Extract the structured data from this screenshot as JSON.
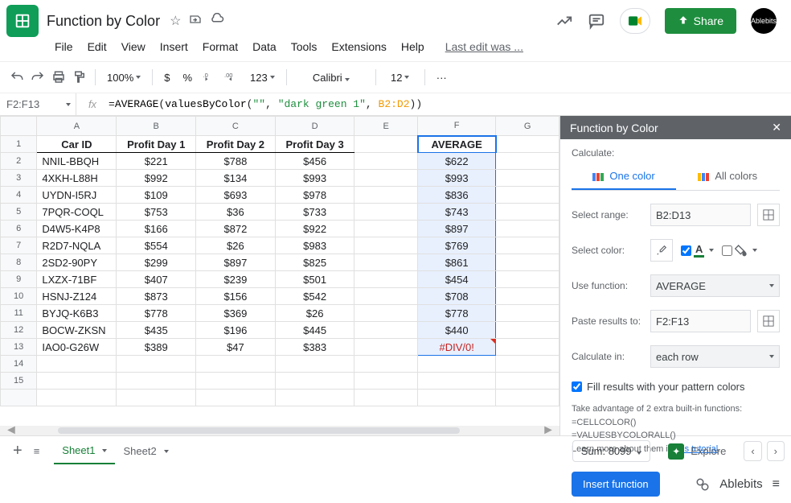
{
  "doc": {
    "title": "Function by Color",
    "last_edit": "Last edit was ..."
  },
  "menu": {
    "file": "File",
    "edit": "Edit",
    "view": "View",
    "insert": "Insert",
    "format": "Format",
    "data": "Data",
    "tools": "Tools",
    "extensions": "Extensions",
    "help": "Help"
  },
  "share": {
    "label": "Share"
  },
  "avatar": {
    "label": "Ablebits"
  },
  "toolbar": {
    "zoom": "100%",
    "dollar": "$",
    "percent": "%",
    "dec_dec": ".0",
    "dec_inc": ".00",
    "numfmt": "123",
    "font": "Calibri",
    "size": "12",
    "ellipsis": "···"
  },
  "namebox": "F2:F13",
  "formula": {
    "fn": "AVERAGE",
    "inner_fn": "valuesByColor",
    "arg1": "\"\"",
    "arg2": "\"dark green 1\"",
    "arg3": "B2:D2"
  },
  "columns": [
    "A",
    "B",
    "C",
    "D",
    "E",
    "F",
    "G"
  ],
  "headers": {
    "A": "Car ID",
    "B": "Profit Day 1",
    "C": "Profit Day 2",
    "D": "Profit Day 3",
    "F": "AVERAGE"
  },
  "rows": [
    {
      "id": "NNIL-BBQH",
      "d1": {
        "v": "$221",
        "c": "red"
      },
      "d2": {
        "v": "$788",
        "c": "green"
      },
      "d3": {
        "v": "$456",
        "c": "green"
      },
      "avg": "$622"
    },
    {
      "id": "4XKH-L88H",
      "d1": {
        "v": "$992",
        "c": "green"
      },
      "d2": {
        "v": "$134",
        "c": "red"
      },
      "d3": {
        "v": "$993",
        "c": "green"
      },
      "avg": "$993"
    },
    {
      "id": "UYDN-I5RJ",
      "d1": {
        "v": "$109",
        "c": "red"
      },
      "d2": {
        "v": "$693",
        "c": "green"
      },
      "d3": {
        "v": "$978",
        "c": "green"
      },
      "avg": "$836"
    },
    {
      "id": "7PQR-COQL",
      "d1": {
        "v": "$753",
        "c": "green"
      },
      "d2": {
        "v": "$36",
        "c": "red"
      },
      "d3": {
        "v": "$733",
        "c": "green"
      },
      "avg": "$743"
    },
    {
      "id": "D4W5-K4P8",
      "d1": {
        "v": "$166",
        "c": "red"
      },
      "d2": {
        "v": "$872",
        "c": "green"
      },
      "d3": {
        "v": "$922",
        "c": "green"
      },
      "avg": "$897"
    },
    {
      "id": "R2D7-NQLA",
      "d1": {
        "v": "$554",
        "c": "green"
      },
      "d2": {
        "v": "$26",
        "c": "red"
      },
      "d3": {
        "v": "$983",
        "c": "green"
      },
      "avg": "$769"
    },
    {
      "id": "2SD2-90PY",
      "d1": {
        "v": "$299",
        "c": "red"
      },
      "d2": {
        "v": "$897",
        "c": "green"
      },
      "d3": {
        "v": "$825",
        "c": "green"
      },
      "avg": "$861"
    },
    {
      "id": "LXZX-71BF",
      "d1": {
        "v": "$407",
        "c": "green"
      },
      "d2": {
        "v": "$239",
        "c": "red"
      },
      "d3": {
        "v": "$501",
        "c": "green"
      },
      "avg": "$454"
    },
    {
      "id": "HSNJ-Z124",
      "d1": {
        "v": "$873",
        "c": "green"
      },
      "d2": {
        "v": "$156",
        "c": "red"
      },
      "d3": {
        "v": "$542",
        "c": "green"
      },
      "avg": "$708"
    },
    {
      "id": "BYJQ-K6B3",
      "d1": {
        "v": "$778",
        "c": "green"
      },
      "d2": {
        "v": "$369",
        "c": "red"
      },
      "d3": {
        "v": "$26",
        "c": "red"
      },
      "avg": "$778"
    },
    {
      "id": "BOCW-ZKSN",
      "d1": {
        "v": "$435",
        "c": "green"
      },
      "d2": {
        "v": "$196",
        "c": "red"
      },
      "d3": {
        "v": "$445",
        "c": "green"
      },
      "avg": "$440"
    },
    {
      "id": "IAO0-G26W",
      "d1": {
        "v": "$389",
        "c": "red"
      },
      "d2": {
        "v": "$47",
        "c": "red"
      },
      "d3": {
        "v": "$383",
        "c": "green"
      },
      "avg": "#DIV/0!"
    }
  ],
  "panel": {
    "title": "Function by Color",
    "calc_label": "Calculate:",
    "tab1": "One color",
    "tab2": "All colors",
    "range_label": "Select range:",
    "range": "B2:D13",
    "color_label": "Select color:",
    "func_label": "Use function:",
    "func": "AVERAGE",
    "paste_label": "Paste results to:",
    "paste": "F2:F13",
    "calcin_label": "Calculate in:",
    "calcin": "each row",
    "fill_label": "Fill results with your pattern colors",
    "hint1": "Take advantage of 2 extra built-in functions:",
    "hint2": "=CELLCOLOR()",
    "hint3": "=VALUESBYCOLORALL()",
    "hint4": "Learn more about them in ",
    "hint_link": "this tutorial",
    "insert": "Insert function",
    "brand": "Ablebits"
  },
  "status": {
    "sheet1": "Sheet1",
    "sheet2": "Sheet2",
    "sum": "Sum: 8099",
    "explore": "Explore"
  }
}
